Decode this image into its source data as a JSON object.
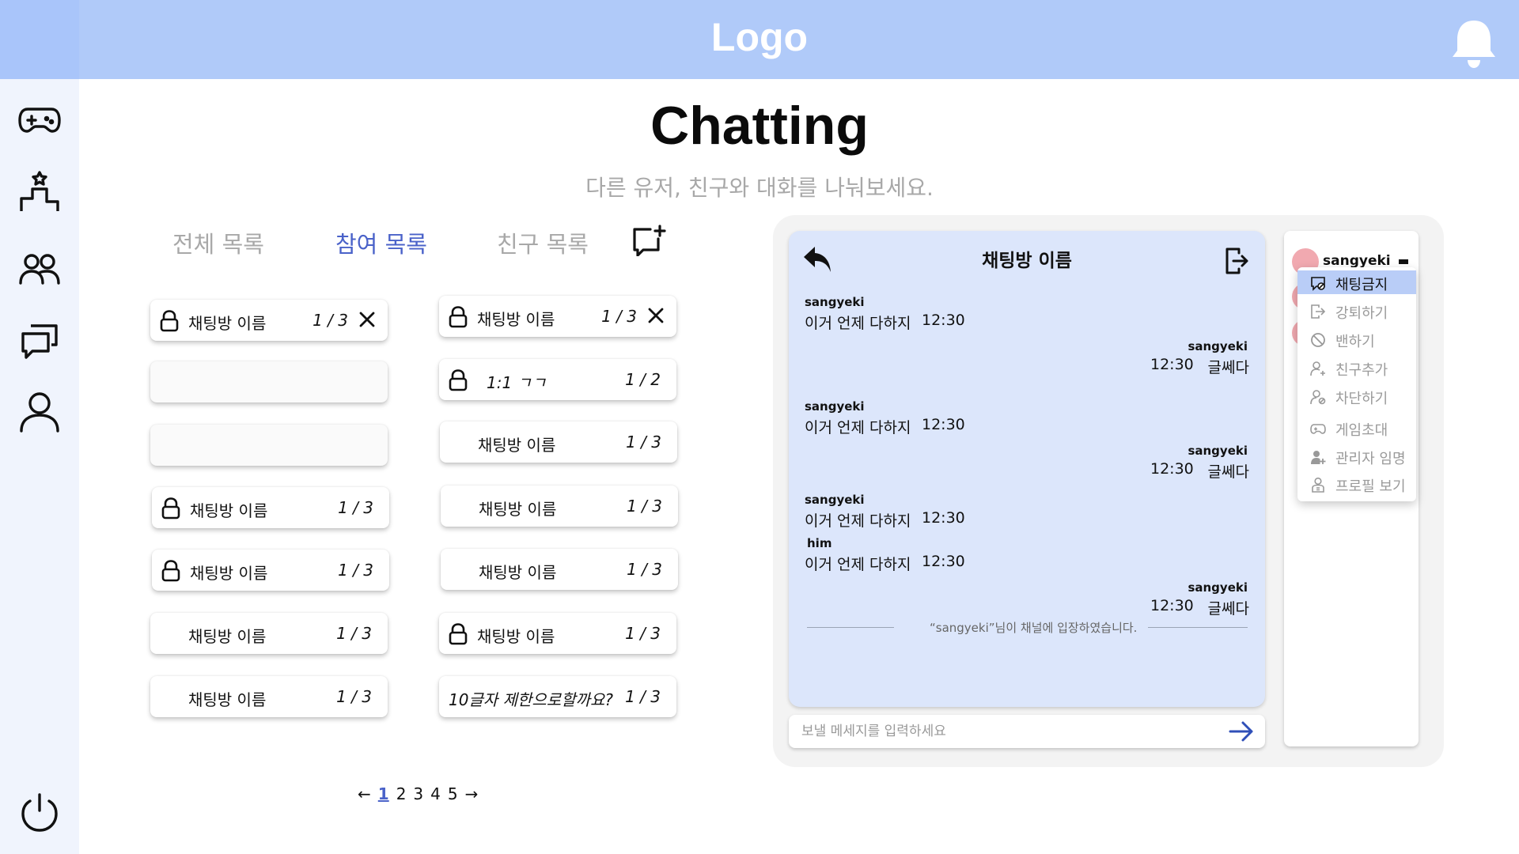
{
  "header": {
    "logo": "Logo"
  },
  "sidebar": {
    "items": [
      {
        "icon": "gamepad-icon"
      },
      {
        "icon": "ranking-podium-icon"
      },
      {
        "icon": "friends-icon"
      },
      {
        "icon": "chat-bubbles-icon"
      },
      {
        "icon": "profile-icon"
      },
      {
        "icon": "power-icon"
      }
    ]
  },
  "page": {
    "title": "Chatting",
    "subtitle": "다른 유저, 친구와 대화를 나눠보세요."
  },
  "tabs": {
    "all": "전체 목록",
    "joined": "참여 목록",
    "friends": "친구 목록",
    "active": "joined"
  },
  "rooms": {
    "left": [
      {
        "locked": true,
        "name": "채팅방 이름",
        "count": "1 / 3",
        "closable": true
      },
      {
        "empty": true
      },
      {
        "empty": true
      },
      {
        "locked": true,
        "name": "채팅방 이름",
        "count": "1 / 3"
      },
      {
        "locked": true,
        "name": "채팅방 이름",
        "count": "1 / 3"
      },
      {
        "locked": false,
        "name": "채팅방 이름",
        "count": "1 / 3"
      },
      {
        "locked": false,
        "name": "채팅방 이름",
        "count": "1 / 3"
      }
    ],
    "right": [
      {
        "locked": true,
        "name": "채팅방 이름",
        "count": "1 / 3",
        "closable": true
      },
      {
        "locked": true,
        "name": "1:1 ㄱㄱ",
        "count": "1 / 2"
      },
      {
        "locked": false,
        "name": "채팅방 이름",
        "count": "1 / 3"
      },
      {
        "locked": false,
        "name": "채팅방 이름",
        "count": "1 / 3"
      },
      {
        "locked": false,
        "name": "채팅방 이름",
        "count": "1 / 3"
      },
      {
        "locked": true,
        "name": "채팅방 이름",
        "count": "1 / 3"
      },
      {
        "locked": false,
        "name": "10글자 제한으로할까요?",
        "count": "1 / 3"
      }
    ]
  },
  "pagination": {
    "prev": "←",
    "pages": [
      "1",
      "2",
      "3",
      "4",
      "5"
    ],
    "current": "1",
    "next": "→"
  },
  "chat": {
    "room_title": "채팅방 이름",
    "messages": [
      {
        "side": "left",
        "sender": "sangyeki",
        "text": "이거 언제 다하지",
        "time": "12:30"
      },
      {
        "side": "right",
        "sender": "sangyeki",
        "text": "글쎄다",
        "time": "12:30"
      },
      {
        "side": "left",
        "sender": "sangyeki",
        "text": "이거 언제 다하지",
        "time": "12:30"
      },
      {
        "side": "right",
        "sender": "sangyeki",
        "text": "글쎄다",
        "time": "12:30"
      },
      {
        "side": "left",
        "sender": "sangyeki",
        "text": "이거 언제 다하지",
        "time": "12:30"
      },
      {
        "side": "left",
        "sender": "him",
        "text": "이거 언제 다하지",
        "time": "12:30"
      },
      {
        "side": "right",
        "sender": "sangyeki",
        "text": "글쎄다",
        "time": "12:30"
      }
    ],
    "system_message": "“sangyeki”님이 채널에 입장하였습니다.",
    "input_placeholder": "보낼 메세지를 입력하세요"
  },
  "members": {
    "selected_name": "sangyeki",
    "menu": [
      {
        "icon": "chat-ban-icon",
        "label": "채팅금지",
        "selected": true
      },
      {
        "icon": "kick-icon",
        "label": "강퇴하기"
      },
      {
        "icon": "ban-icon",
        "label": "밴하기"
      },
      {
        "icon": "add-friend-icon",
        "label": "친구추가"
      },
      {
        "icon": "block-user-icon",
        "label": "차단하기"
      },
      {
        "icon": "game-invite-icon",
        "label": "게임초대"
      },
      {
        "icon": "admin-appoint-icon",
        "label": "관리자 임명"
      },
      {
        "icon": "view-profile-icon",
        "label": "프로필 보기"
      }
    ]
  },
  "colors": {
    "header": "#b0caf9",
    "sidebar": "#f0f4fd",
    "accent": "#4a62c9",
    "chat_bg": "#dce6fb",
    "menu_selected": "#b9cdf7",
    "avatar": "#f1a9b0"
  }
}
